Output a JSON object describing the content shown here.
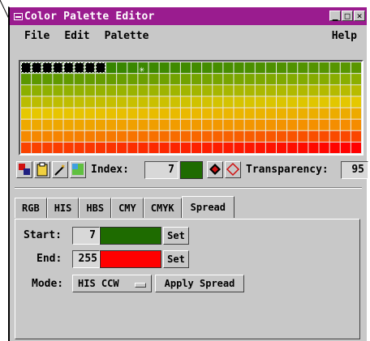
{
  "window": {
    "title": "Color Palette Editor"
  },
  "titlebar_buttons": [
    "minimize-icon",
    "maximize-icon",
    "close-icon"
  ],
  "menu": {
    "file": "File",
    "edit": "Edit",
    "palette": "Palette",
    "help": "Help"
  },
  "palette": {
    "columns": 32,
    "rows": 8,
    "selection_start": 0,
    "selection_end": 7,
    "marker_index": 11,
    "top_color": "#2a7f00",
    "bottom_color": "#ff0000"
  },
  "tools": [
    "palette-swap-icon",
    "clipboard-icon",
    "magic-wand-icon",
    "gradient-icon"
  ],
  "index": {
    "label": "Index:",
    "value": "7",
    "color": "#1e6b00"
  },
  "transparency": {
    "label": "Transparency:",
    "value": "95"
  },
  "tabs": [
    "RGB",
    "HIS",
    "HBS",
    "CMY",
    "CMYK",
    "Spread"
  ],
  "active_tab": "Spread",
  "spread": {
    "start_label": "Start:",
    "start_value": "7",
    "start_color": "#1e6b00",
    "set_label": "Set",
    "end_label": "End:",
    "end_value": "255",
    "end_color": "#ff0000",
    "mode_label": "Mode:",
    "mode_value": "HIS CCW",
    "apply_label": "Apply Spread"
  }
}
